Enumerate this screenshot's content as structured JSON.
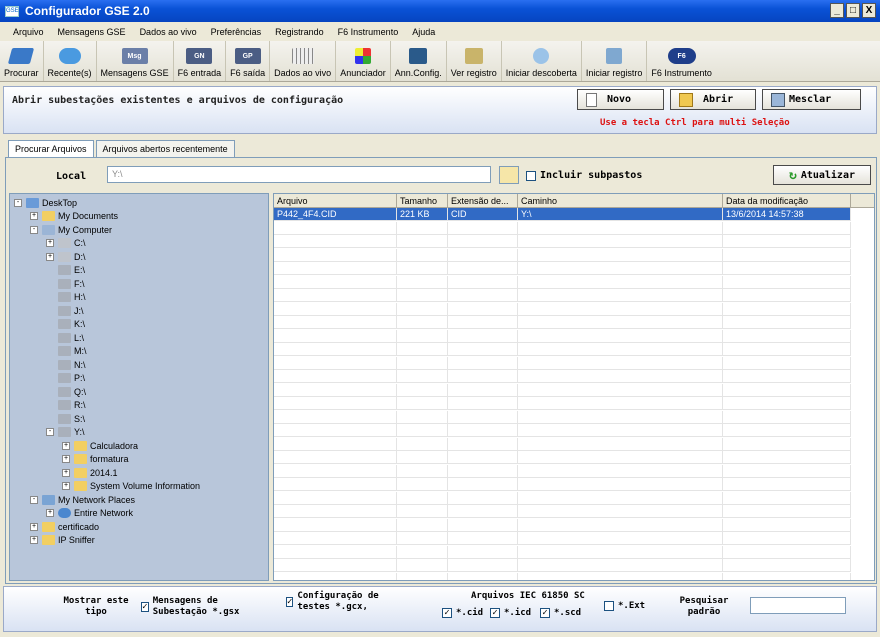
{
  "window": {
    "title": "Configurador GSE 2.0",
    "min": "_",
    "max": "□",
    "close": "X"
  },
  "menu": [
    "Arquivo",
    "Mensagens GSE",
    "Dados ao vivo",
    "Preferências",
    "Registrando",
    "F6 Instrumento",
    "Ajuda"
  ],
  "toolbar": [
    "Procurar",
    "Recente(s)",
    "Mensagens GSE",
    "F6 entrada",
    "F6 saída",
    "Dados ao vivo",
    "Anunciador",
    "Ann.Config.",
    "Ver registro",
    "Iniciar descoberta",
    "Iniciar registro",
    "F6 Instrumento"
  ],
  "toolbar_icon_text": {
    "msg": "Msg",
    "gn": "GN",
    "gp": "GP",
    "f6": "F6"
  },
  "panel": {
    "heading": "Abrir subestações existentes e arquivos de configuração",
    "novo": "Novo",
    "abrir": "Abrir",
    "mesclar": "Mesclar",
    "hint": "Use a tecla Ctrl para multi Seleção"
  },
  "tabs": [
    "Procurar Arquivos",
    "Arquivos abertos recentemente"
  ],
  "browse": {
    "local_label": "Local",
    "local_value": "Y:\\",
    "include_label": "Incluir subpastos",
    "refresh": "Atualizar"
  },
  "tree": [
    {
      "label": "DeskTop",
      "level": 0,
      "pm": "-",
      "icon": "desktop"
    },
    {
      "label": "My Documents",
      "level": 1,
      "pm": "+",
      "icon": "folder"
    },
    {
      "label": "My Computer",
      "level": 1,
      "pm": "-",
      "icon": "computer"
    },
    {
      "label": "C:\\",
      "level": 2,
      "pm": "+",
      "icon": "drive"
    },
    {
      "label": "D:\\",
      "level": 2,
      "pm": "+",
      "icon": "drive"
    },
    {
      "label": "E:\\",
      "level": 2,
      "pm": "",
      "icon": "netdrive"
    },
    {
      "label": "F:\\",
      "level": 2,
      "pm": "",
      "icon": "netdrive"
    },
    {
      "label": "H:\\",
      "level": 2,
      "pm": "",
      "icon": "netdrive"
    },
    {
      "label": "J:\\",
      "level": 2,
      "pm": "",
      "icon": "netdrive"
    },
    {
      "label": "K:\\",
      "level": 2,
      "pm": "",
      "icon": "netdrive"
    },
    {
      "label": "L:\\",
      "level": 2,
      "pm": "",
      "icon": "netdrive"
    },
    {
      "label": "M:\\",
      "level": 2,
      "pm": "",
      "icon": "netdrive"
    },
    {
      "label": "N:\\",
      "level": 2,
      "pm": "",
      "icon": "netdrive"
    },
    {
      "label": "P:\\",
      "level": 2,
      "pm": "",
      "icon": "netdrive"
    },
    {
      "label": "Q:\\",
      "level": 2,
      "pm": "",
      "icon": "netdrive"
    },
    {
      "label": "R:\\",
      "level": 2,
      "pm": "",
      "icon": "netdrive"
    },
    {
      "label": "S:\\",
      "level": 2,
      "pm": "",
      "icon": "netdrive"
    },
    {
      "label": "Y:\\",
      "level": 2,
      "pm": "-",
      "icon": "netdrive"
    },
    {
      "label": "Calculadora",
      "level": 3,
      "pm": "+",
      "icon": "folder"
    },
    {
      "label": "formatura",
      "level": 3,
      "pm": "+",
      "icon": "folder"
    },
    {
      "label": "2014.1",
      "level": 3,
      "pm": "+",
      "icon": "folder"
    },
    {
      "label": "System Volume Information",
      "level": 3,
      "pm": "+",
      "icon": "folder"
    },
    {
      "label": "My Network Places",
      "level": 1,
      "pm": "-",
      "icon": "network"
    },
    {
      "label": "Entire Network",
      "level": 2,
      "pm": "+",
      "icon": "globe"
    },
    {
      "label": "certificado",
      "level": 1,
      "pm": "+",
      "icon": "folder"
    },
    {
      "label": "IP Sniffer",
      "level": 1,
      "pm": "+",
      "icon": "folder"
    }
  ],
  "grid": {
    "columns": [
      "Arquivo",
      "Tamanho",
      "Extensão de...",
      "Caminho",
      "Data da modificação"
    ],
    "rows": [
      [
        "P442_4F4.CID",
        "221 KB",
        "CID",
        "Y:\\",
        "13/6/2014 14:57:38"
      ]
    ]
  },
  "filters": {
    "show_type": "Mostrar este tipo",
    "gsx": "Mensagens de Subestação *.gsx",
    "gcx": "Configuração de testes *.gcx,",
    "iec_title": "Arquivos IEC 61850 SC",
    "cid": "*.cid",
    "icd": "*.icd",
    "scd": "*.scd",
    "ext": "*.Ext",
    "search": "Pesquisar padrão",
    "checked": {
      "gsx": true,
      "gcx": true,
      "cid": true,
      "icd": true,
      "scd": true,
      "ext": false
    }
  },
  "colors": {
    "titlebar": "#0a52d6",
    "selection": "#316ac5",
    "tree_bg": "#b8c6da",
    "hint": "#dd1111"
  }
}
